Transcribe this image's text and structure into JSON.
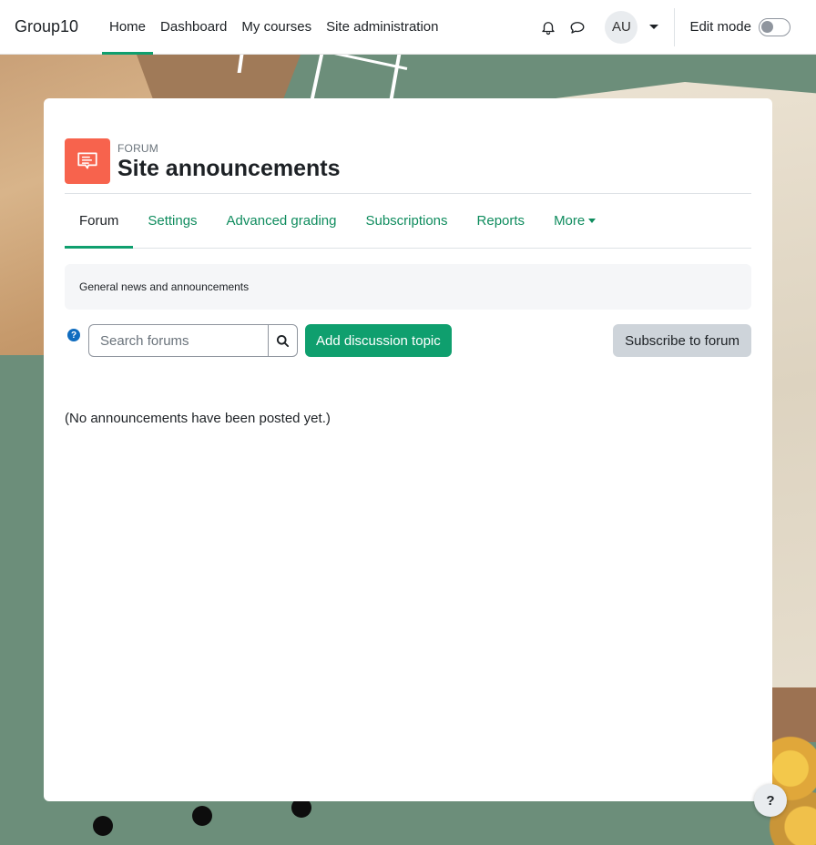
{
  "navbar": {
    "brand": "Group10",
    "items": [
      {
        "label": "Home",
        "active": true
      },
      {
        "label": "Dashboard",
        "active": false
      },
      {
        "label": "My courses",
        "active": false
      },
      {
        "label": "Site administration",
        "active": false
      }
    ],
    "user_initials": "AU",
    "edit_mode_label": "Edit mode",
    "edit_mode_on": false
  },
  "header": {
    "module_type": "FORUM",
    "title": "Site announcements",
    "icon": "forum-speech-bubble-icon",
    "icon_color": "#f7634d"
  },
  "tabs": [
    {
      "label": "Forum",
      "active": true
    },
    {
      "label": "Settings",
      "active": false
    },
    {
      "label": "Advanced grading",
      "active": false
    },
    {
      "label": "Subscriptions",
      "active": false
    },
    {
      "label": "Reports",
      "active": false
    },
    {
      "label": "More",
      "active": false,
      "dropdown": true
    }
  ],
  "intro": "General news and announcements",
  "toolbar": {
    "search_placeholder": "Search forums",
    "add_label": "Add discussion topic",
    "subscribe_label": "Subscribe to forum"
  },
  "empty_message": "(No announcements have been posted yet.)",
  "footer_help": "?",
  "colors": {
    "accent": "#0f9f6e",
    "link": "#0f8c5e",
    "forum_icon_bg": "#f7634d",
    "secondary_button": "#ced4da"
  }
}
